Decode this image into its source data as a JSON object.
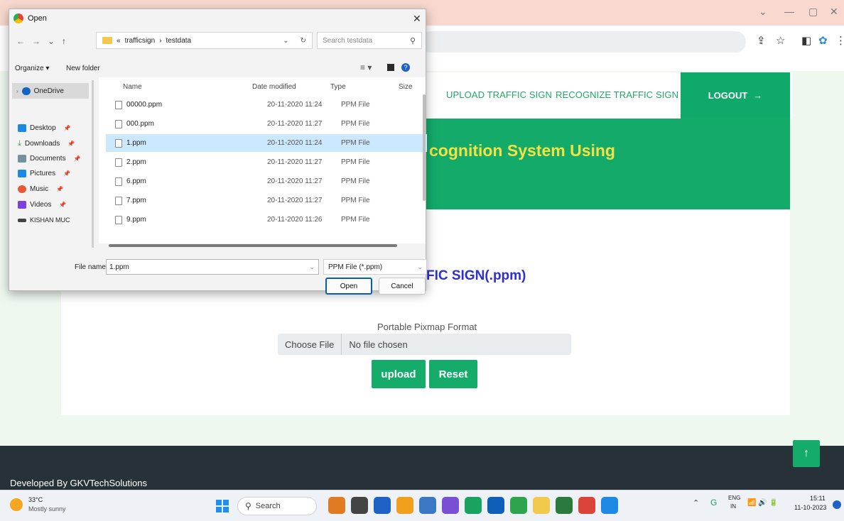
{
  "browser": {
    "window_controls": [
      "⌄",
      "—",
      "▢",
      "✕"
    ]
  },
  "web": {
    "nav": {
      "upload_label": "UPLOAD TRAFFIC SIGN",
      "recognize_label": "RECOGNIZE TRAFFIC SIGN",
      "logout_label": "LOGOUT",
      "logout_arrow": "→"
    },
    "hero_title": "cognition System Using",
    "upload_heading": "FIC SIGN(.ppm)",
    "format_label": "Portable Pixmap Format",
    "file_input": {
      "button_label": "Choose File",
      "status": "No file chosen"
    },
    "upload_button": "upload",
    "reset_button": "Reset",
    "footer_text": "Developed By GKVTechSolutions",
    "to_top": "↑",
    "colors": {
      "accent": "#13aa6a",
      "hero_title": "#f4e243",
      "heading": "#2d2fd0",
      "footer": "#263238"
    }
  },
  "dialog": {
    "title": "Open",
    "close": "✕",
    "path": [
      "«",
      "trafficsign",
      "›",
      "testdata"
    ],
    "search_placeholder": "Search testdata",
    "toolbar": {
      "organize": "Organize ▾",
      "new_folder": "New folder"
    },
    "sidebar": [
      {
        "label": "OneDrive",
        "color": "#1565c0"
      },
      {
        "label": "Desktop",
        "color": "#1e88e5"
      },
      {
        "label": "Downloads",
        "color": "#2e9e5b"
      },
      {
        "label": "Documents",
        "color": "#78909c"
      },
      {
        "label": "Pictures",
        "color": "#1e88e5"
      },
      {
        "label": "Music",
        "color": "#e65a3a"
      },
      {
        "label": "Videos",
        "color": "#7b3fe4"
      },
      {
        "label": "KISHAN MUC",
        "color": "#444444"
      }
    ],
    "columns": [
      "Name",
      "Date modified",
      "Type",
      "Size"
    ],
    "files": [
      {
        "name": "00000.ppm",
        "date": "20-11-2020 11:24",
        "type": "PPM File"
      },
      {
        "name": "000.ppm",
        "date": "20-11-2020 11:27",
        "type": "PPM File"
      },
      {
        "name": "1.ppm",
        "date": "20-11-2020 11:24",
        "type": "PPM File",
        "selected": true
      },
      {
        "name": "2.ppm",
        "date": "20-11-2020 11:27",
        "type": "PPM File"
      },
      {
        "name": "6.ppm",
        "date": "20-11-2020 11:27",
        "type": "PPM File"
      },
      {
        "name": "7.ppm",
        "date": "20-11-2020 11:27",
        "type": "PPM File"
      },
      {
        "name": "9.ppm",
        "date": "20-11-2020 11:26",
        "type": "PPM File"
      }
    ],
    "file_name_label": "File name:",
    "file_name_value": "1.ppm",
    "file_type_value": "PPM File (*.ppm)",
    "open_button": "Open",
    "cancel_button": "Cancel"
  },
  "taskbar": {
    "weather_temp": "33°C",
    "weather_desc": "Mostly sunny",
    "search_label": "Search",
    "apps": [
      "#e07b24",
      "#444444",
      "#1e62c6",
      "#f0a01c",
      "#3b77c5",
      "#7b4fd4",
      "#1aa260",
      "#0f5fb8",
      "#2ea44f",
      "#f2c94c",
      "#2b7a3d",
      "#db4437",
      "#1e88e5"
    ],
    "lang_top": "ENG",
    "lang_bottom": "IN",
    "time": "15:11",
    "date": "11-10-2023"
  }
}
